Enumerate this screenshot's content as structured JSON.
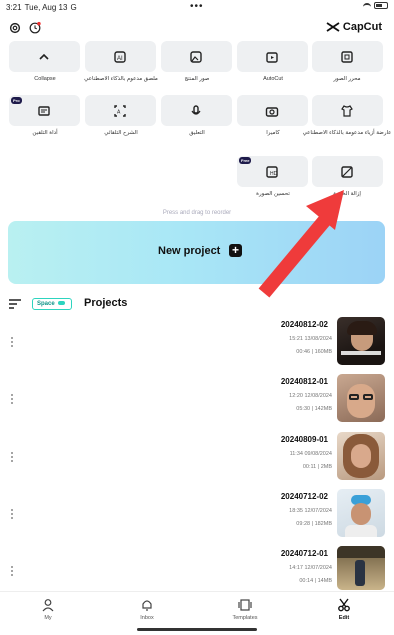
{
  "status_bar": {
    "time": "3:21",
    "date": "Tue, Aug 13",
    "g": "G",
    "dots": "•••"
  },
  "header": {
    "logo_text": "CapCut"
  },
  "tools_row1": [
    {
      "label": "Collapse",
      "icon": "chevron-up-icon"
    },
    {
      "label": "ملصق مدعوم بالذكاء الاصطناعي",
      "icon": "ai-sticker-icon"
    },
    {
      "label": "صور المنتج",
      "icon": "ai-product-image-icon"
    },
    {
      "label": "AutoCut",
      "icon": "autocut-icon"
    },
    {
      "label": "محرر الصور",
      "icon": "photo-editor-icon"
    }
  ],
  "tools_row2": [
    {
      "label": "أداة التلقين",
      "icon": "teleprompter-icon",
      "badge": "Pro"
    },
    {
      "label": "الشرح التلقائي",
      "icon": "auto-captions-icon"
    },
    {
      "label": "التعليق",
      "icon": "voiceover-icon"
    },
    {
      "label": "كاميرا",
      "icon": "camera-icon"
    },
    {
      "label": "عارضة أزياء مدعومة بالذكاء الاصطناعي",
      "icon": "ai-model-icon"
    }
  ],
  "tools_row3": [
    {
      "label": "تحسين الصورة",
      "icon": "enhance-image-icon",
      "badge": "Free"
    },
    {
      "label": "إزالة الخلفية",
      "icon": "remove-background-icon"
    }
  ],
  "hint": "Press and drag to reorder",
  "new_project": {
    "label": "New project",
    "plus": "+"
  },
  "projects_header": {
    "space_label": "Space",
    "title": "Projects"
  },
  "projects": [
    {
      "name": "20240812-02",
      "date": "15:21 13/08/2024",
      "duration": "00:46",
      "size": "160MB"
    },
    {
      "name": "20240812-01",
      "date": "12:20 12/08/2024",
      "duration": "05:30",
      "size": "142MB"
    },
    {
      "name": "20240809-01",
      "date": "11:34 09/08/2024",
      "duration": "00:11",
      "size": "2MB"
    },
    {
      "name": "20240712-02",
      "date": "18:35 12/07/2024",
      "duration": "09:28",
      "size": "182MB"
    },
    {
      "name": "20240712-01",
      "date": "14:17 12/07/2024",
      "duration": "00:14",
      "size": "14MB"
    }
  ],
  "bottom_nav": [
    {
      "label": "My",
      "icon": "person-icon"
    },
    {
      "label": "Inbox",
      "icon": "bell-icon"
    },
    {
      "label": "Templates",
      "icon": "templates-icon"
    },
    {
      "label": "Edit",
      "icon": "scissors-icon",
      "active": true
    }
  ],
  "colors": {
    "accent_arrow": "#ef3b3b",
    "space_border": "#2dd4bf",
    "tile_bg": "#eef0f2"
  }
}
